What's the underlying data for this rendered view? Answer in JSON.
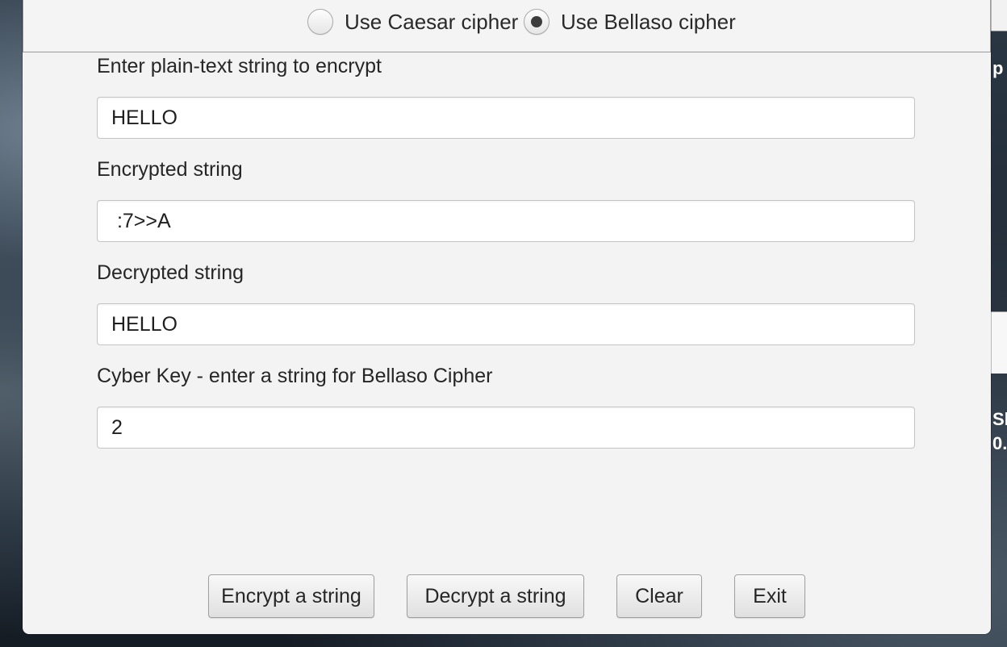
{
  "cipher_options": {
    "caesar_label": "Use Caesar cipher",
    "caesar_selected": false,
    "bellaso_label": "Use Bellaso cipher",
    "bellaso_selected": true
  },
  "fields": {
    "plain_label": "Enter plain-text string to encrypt",
    "plain_value": "HELLO",
    "encrypted_label": "Encrypted string",
    "encrypted_value": " :7>>A",
    "decrypted_label": "Decrypted string",
    "decrypted_value": "HELLO",
    "key_label": "Cyber Key - enter a string for Bellaso Cipher",
    "key_value": "2"
  },
  "buttons": {
    "encrypt": "Encrypt a string",
    "decrypt": "Decrypt a string",
    "clear": "Clear",
    "exit": "Exit"
  },
  "background_windows": {
    "top_right_text": "p",
    "mid_right_text_1": "Sh",
    "mid_right_text_2": "0."
  }
}
